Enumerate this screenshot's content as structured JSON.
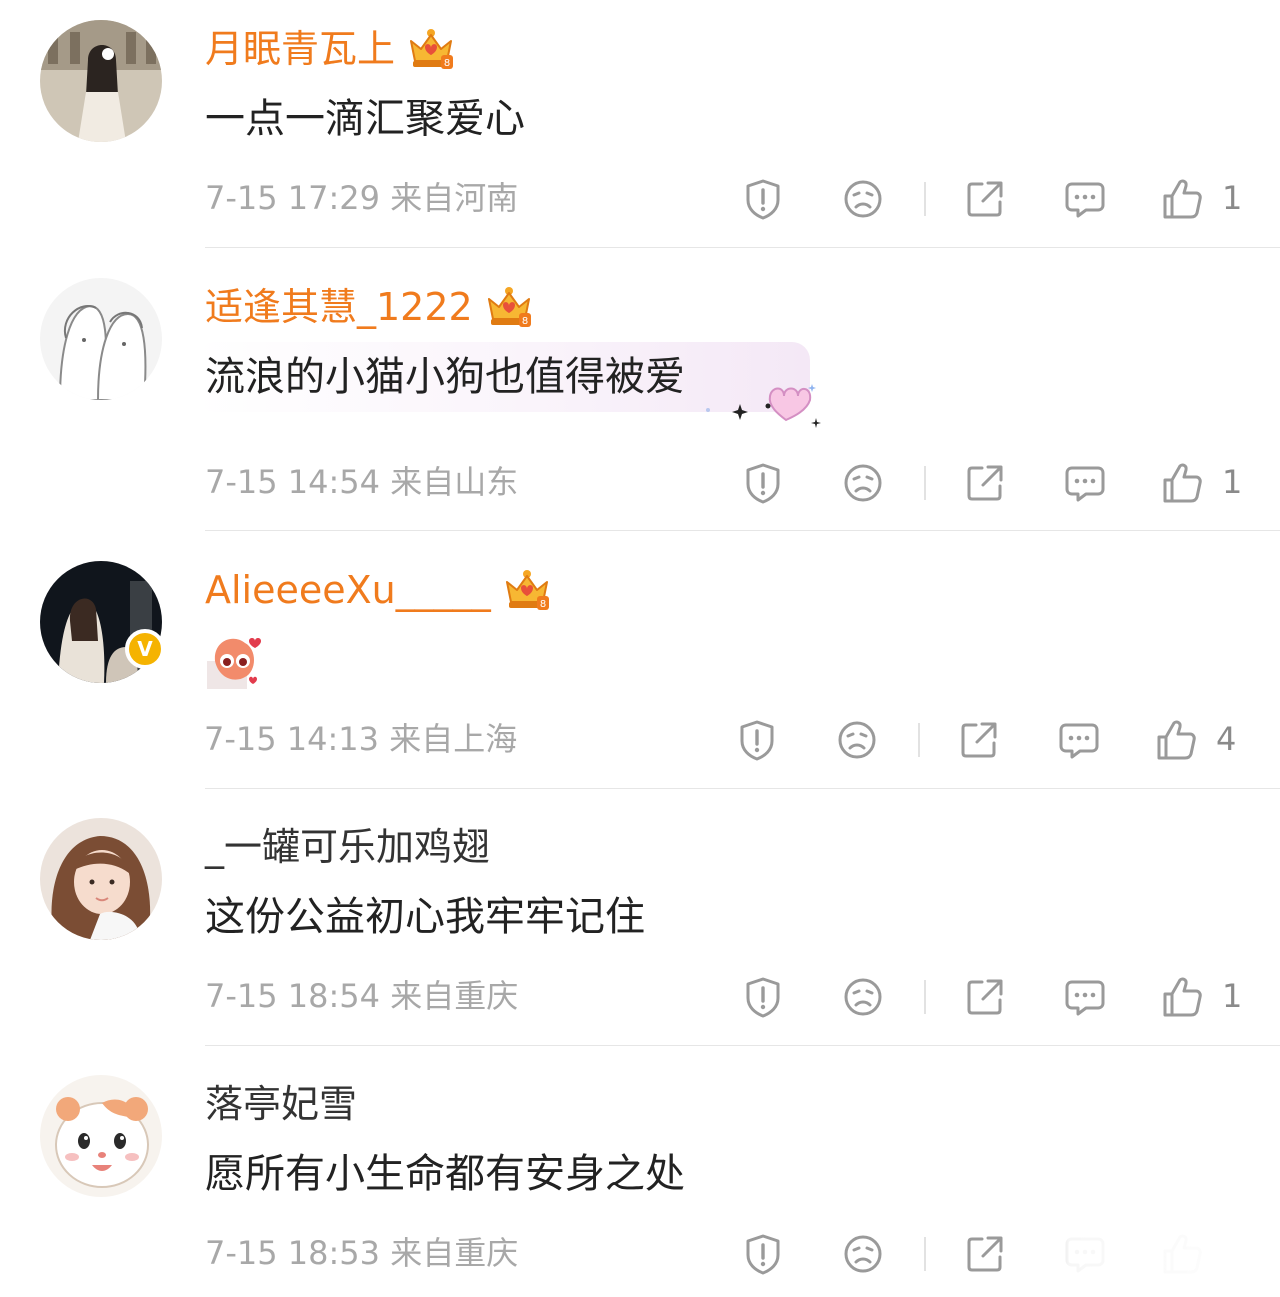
{
  "colors": {
    "vip_name": "#f07b1d",
    "normal_name": "#333333",
    "text": "#222222",
    "meta": "#a8a8a8",
    "icon": "#9a9a9a",
    "verified_badge": "#f5b301"
  },
  "comments": [
    {
      "username": "月眠青瓦上",
      "vip": true,
      "text": "一点一滴汇聚爱心",
      "meta": "7-15 17:29  来自河南",
      "like_count": "1",
      "icons": [
        "report-icon",
        "dislike-icon",
        "share-icon",
        "comment-icon",
        "thumbs-up-icon"
      ]
    },
    {
      "username": "适逢其慧_1222",
      "vip": true,
      "text": "流浪的小猫小狗也值得被爱",
      "meta": "7-15 14:54  来自山东",
      "like_count": "1",
      "decoration": "heart-sparkle"
    },
    {
      "username": "AlieeeeXu_____",
      "vip": true,
      "verified": true,
      "verified_label": "V",
      "text": "",
      "sticker": "cute-face-sticker",
      "meta": "7-15 14:13  来自上海",
      "like_count": "4"
    },
    {
      "username": "_一罐可乐加鸡翅",
      "vip": false,
      "text": "这份公益初心我牢牢记住",
      "meta": "7-15 18:54  来自重庆",
      "like_count": "1"
    },
    {
      "username": "落亭妃雪",
      "vip": false,
      "text": "愿所有小生命都有安身之处",
      "meta": "7-15 18:53  来自重庆",
      "like_count": ""
    }
  ]
}
